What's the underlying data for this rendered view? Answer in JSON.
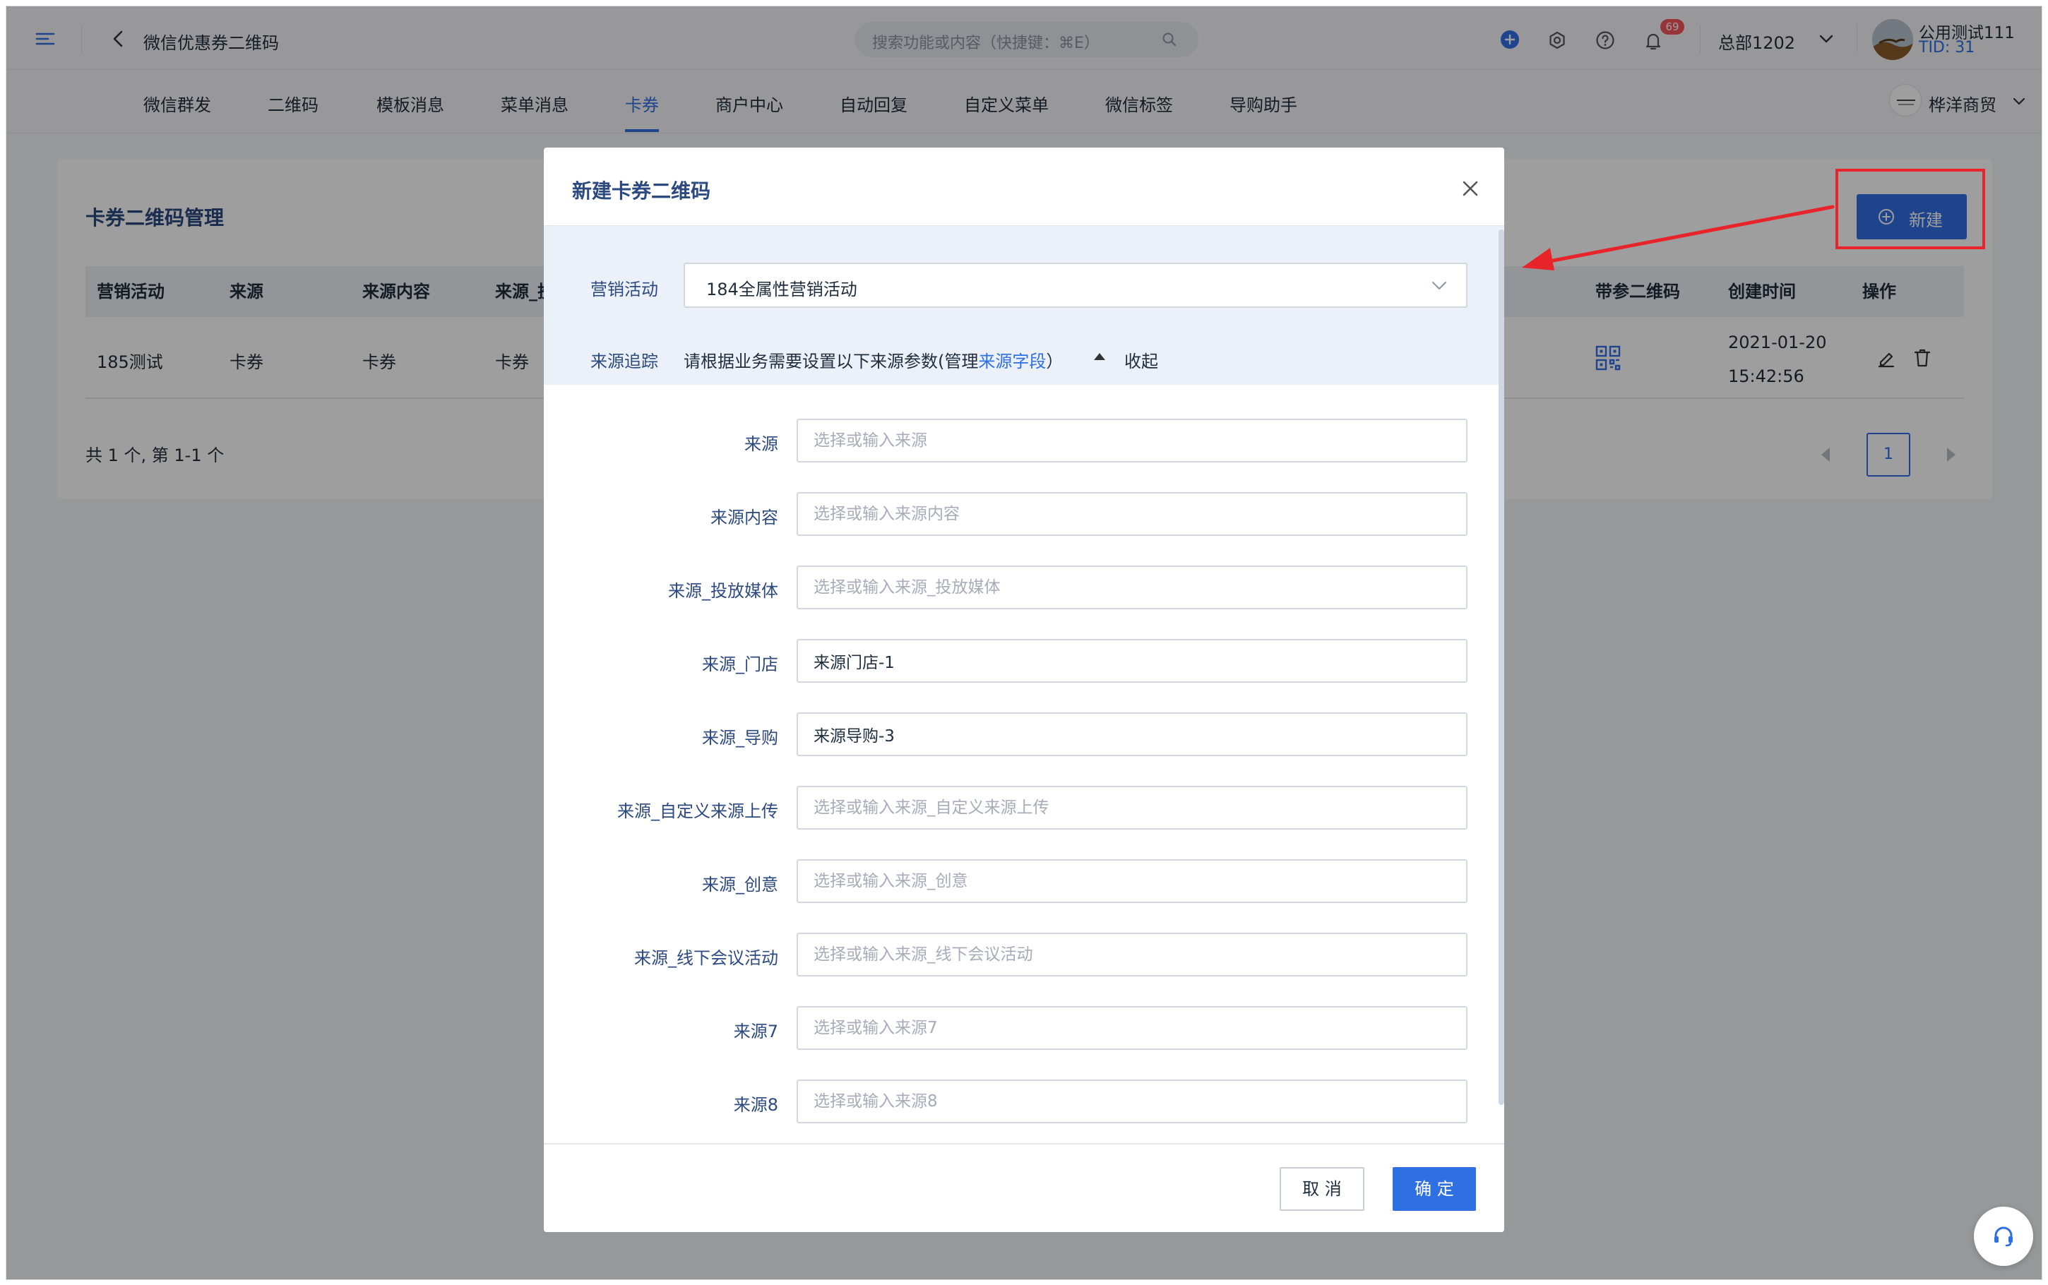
{
  "topbar": {
    "title": "微信优惠券二维码",
    "search_placeholder": "搜索功能或内容（快捷键：⌘E）",
    "notification_count": "69",
    "org": "总部1202",
    "user_name": "公用测试111",
    "user_tid": "TID: 31"
  },
  "nav": {
    "items": [
      "微信群发",
      "二维码",
      "模板消息",
      "菜单消息",
      "卡券",
      "商户中心",
      "自动回复",
      "自定义菜单",
      "微信标签",
      "导购助手"
    ],
    "active": "卡券",
    "merchant": "桦洋商贸"
  },
  "card": {
    "title": "卡券二维码管理",
    "new_button": "新建",
    "columns": [
      "营销活动",
      "来源",
      "来源内容",
      "来源_投放媒体",
      "带参二维码",
      "创建时间",
      "操作"
    ],
    "rows": [
      {
        "activity": "185测试",
        "source": "卡券",
        "content": "卡券",
        "media": "卡券",
        "created_date": "2021-01-20",
        "created_time": "15:42:56"
      }
    ],
    "pagination_summary": "共 1 个, 第 1-1 个",
    "current_page": "1"
  },
  "modal": {
    "title": "新建卡券二维码",
    "activity_label": "营销活动",
    "activity_value": "184全属性营销活动",
    "trace_label": "来源追踪",
    "trace_text": "请根据业务需要设置以下来源参数(管理",
    "trace_link": "来源字段",
    "trace_text_end": "）",
    "collapse_label": "收起",
    "fields": [
      {
        "label": "来源",
        "placeholder": "选择或输入来源",
        "value": ""
      },
      {
        "label": "来源内容",
        "placeholder": "选择或输入来源内容",
        "value": ""
      },
      {
        "label": "来源_投放媒体",
        "placeholder": "选择或输入来源_投放媒体",
        "value": ""
      },
      {
        "label": "来源_门店",
        "placeholder": "",
        "value": "来源门店-1"
      },
      {
        "label": "来源_导购",
        "placeholder": "",
        "value": "来源导购-3"
      },
      {
        "label": "来源_自定义来源上传",
        "placeholder": "选择或输入来源_自定义来源上传",
        "value": ""
      },
      {
        "label": "来源_创意",
        "placeholder": "选择或输入来源_创意",
        "value": ""
      },
      {
        "label": "来源_线下会议活动",
        "placeholder": "选择或输入来源_线下会议活动",
        "value": ""
      },
      {
        "label": "来源7",
        "placeholder": "选择或输入来源7",
        "value": ""
      },
      {
        "label": "来源8",
        "placeholder": "选择或输入来源8",
        "value": ""
      }
    ],
    "cancel_label": "取 消",
    "confirm_label": "确 定"
  },
  "colors": {
    "primary": "#2f6fe4",
    "heading": "#2c4a80",
    "annotation_red": "#e8232a",
    "badge": "#f2545b"
  }
}
